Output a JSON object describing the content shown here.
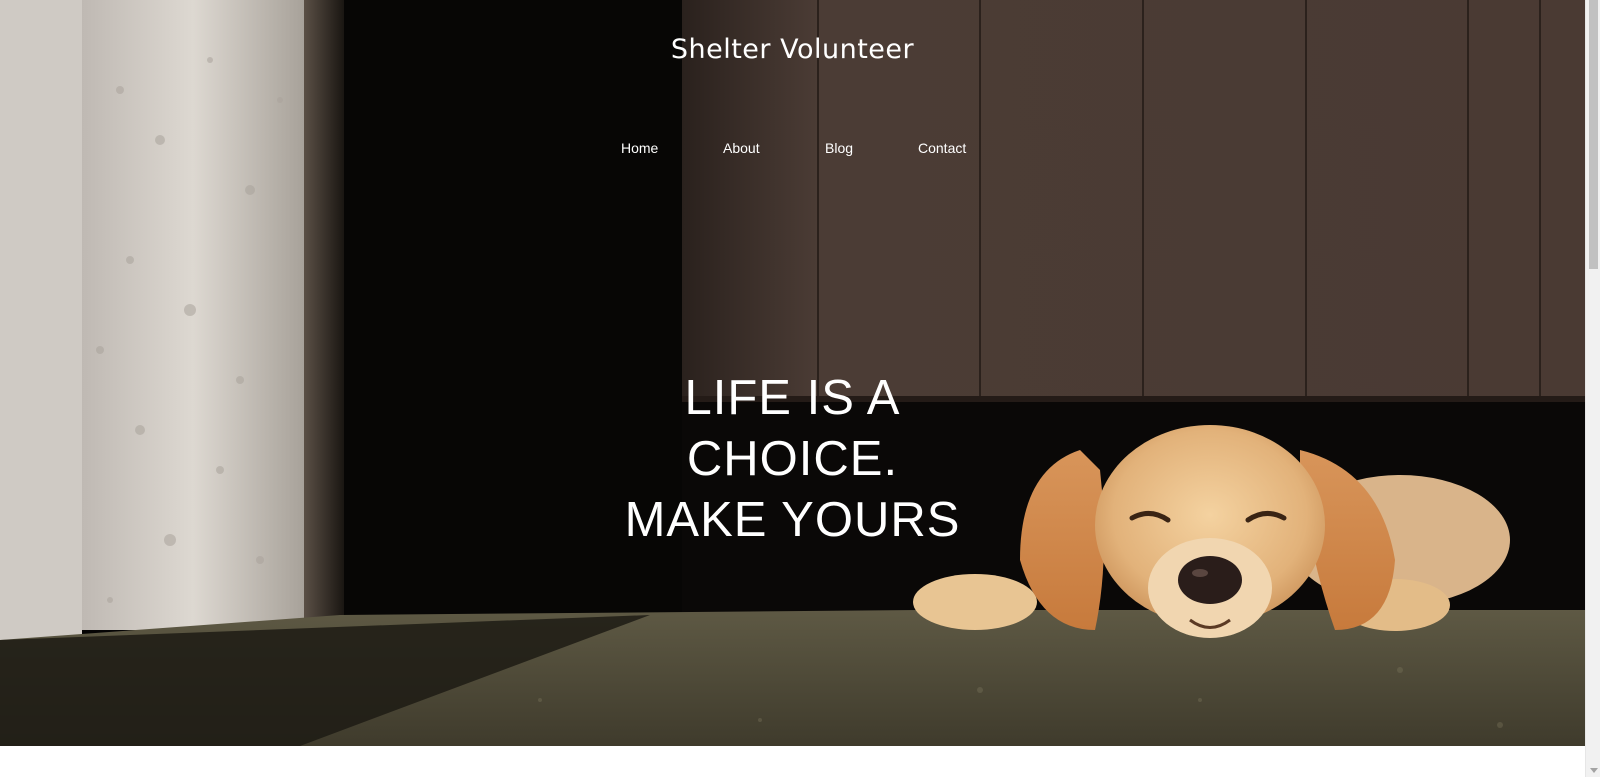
{
  "site": {
    "title": "Shelter Volunteer"
  },
  "nav": {
    "items": [
      {
        "label": "Home"
      },
      {
        "label": "About"
      },
      {
        "label": "Blog"
      },
      {
        "label": "Contact"
      }
    ]
  },
  "hero": {
    "headline_lines": [
      "LIFE IS A",
      "CHOICE.",
      "MAKE YOURS"
    ],
    "image_subject": "golden-retriever-resting-under-gate",
    "colors": {
      "wall": "#d9d4cd",
      "gate": "#4a3a33",
      "shadow": "#000000",
      "ground": "#5a5642",
      "dog": "#e2b27a"
    }
  },
  "colors": {
    "text": "#ffffff",
    "page_bg": "#ffffff",
    "scrollbar_track": "#f1f1f1",
    "scrollbar_thumb": "#c1c1c1"
  }
}
